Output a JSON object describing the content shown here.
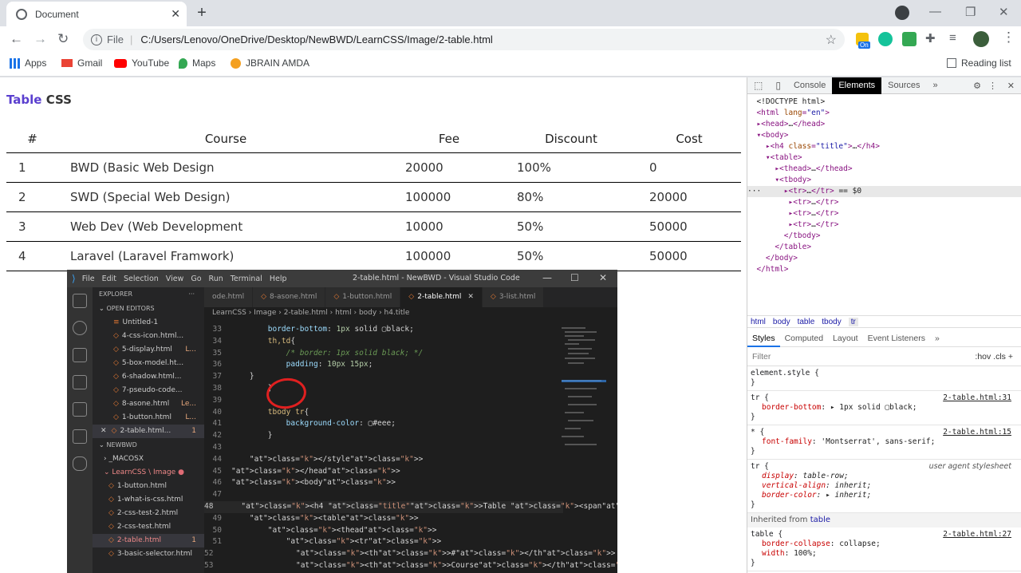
{
  "browser": {
    "tab_title": "Document",
    "tab_close": "✕",
    "new_tab": "+",
    "address_label": "File",
    "url": "C:/Users/Lenovo/OneDrive/Desktop/NewBWD/LearnCSS/Image/2-table.html",
    "extension_badge": "On",
    "bookmarks": [
      "Apps",
      "Gmail",
      "YouTube",
      "Maps",
      "JBRAIN AMDA"
    ],
    "reading_list": "Reading list"
  },
  "page": {
    "title_word1": "Table",
    "title_word2": " CSS",
    "table": {
      "headers": [
        "#",
        "Course",
        "Fee",
        "Discount",
        "Cost"
      ],
      "rows": [
        [
          "1",
          "BWD (Basic Web Design",
          "20000",
          "100%",
          "0"
        ],
        [
          "2",
          "SWD (Special Web Design)",
          "100000",
          "80%",
          "20000"
        ],
        [
          "3",
          "Web Dev (Web Development",
          "10000",
          "50%",
          "50000"
        ],
        [
          "4",
          "Laravel (Laravel Framwork)",
          "100000",
          "50%",
          "50000"
        ]
      ]
    }
  },
  "devtools": {
    "tabs": [
      "Console",
      "Elements",
      "Sources"
    ],
    "active_tab": "Elements",
    "selected_suffix": " == $0",
    "breadcrumb": [
      "html",
      "body",
      "table",
      "tbody",
      "tr"
    ],
    "style_tabs": [
      "Styles",
      "Computed",
      "Layout",
      "Event Listeners"
    ],
    "filter_placeholder": "Filter",
    "filter_tools": ":hov  .cls  +",
    "rules": [
      {
        "selector": "element.style {",
        "source": "",
        "props": []
      },
      {
        "selector": "tr {",
        "source": "2-table.html:31",
        "props": [
          [
            "border-bottom",
            "▸ 1px solid ▢black;"
          ]
        ]
      },
      {
        "selector": "* {",
        "source": "2-table.html:15",
        "props": [
          [
            "font-family",
            "'Montserrat', sans-serif;"
          ]
        ]
      },
      {
        "selector": "tr {",
        "source": "user agent stylesheet",
        "props": [
          [
            "display",
            "table-row;"
          ],
          [
            "vertical-align",
            "inherit;"
          ],
          [
            "border-color",
            "▸ inherit;"
          ]
        ]
      }
    ],
    "inherited_label": "Inherited from",
    "inherited_from": "table",
    "inherited_rule": {
      "selector": "table {",
      "source": "2-table.html:27",
      "props": [
        [
          "border-collapse",
          "collapse;"
        ],
        [
          "width",
          "100%;"
        ]
      ]
    }
  },
  "vscode": {
    "menus": [
      "File",
      "Edit",
      "Selection",
      "View",
      "Go",
      "Run",
      "Terminal",
      "Help"
    ],
    "window_title": "2-table.html - NewBWD - Visual Studio Code",
    "explorer_label": "EXPLORER",
    "open_editors_label": "OPEN EDITORS",
    "open_editors": [
      {
        "name": "Untitled-1",
        "extra": ""
      },
      {
        "name": "4-css-icon.html...",
        "extra": ""
      },
      {
        "name": "5-display.html",
        "extra": "L..."
      },
      {
        "name": "5-box-model.ht...",
        "extra": ""
      },
      {
        "name": "6-shadow.html...",
        "extra": ""
      },
      {
        "name": "7-pseudo-code...",
        "extra": ""
      },
      {
        "name": "8-asone.html",
        "extra": "Le..."
      },
      {
        "name": "1-button.html",
        "extra": "L..."
      },
      {
        "name": "2-table.html...",
        "extra": "1"
      }
    ],
    "workspace_label": "NEWBWD",
    "folders": [
      "_MACOSX",
      "LearnCSS \\ Image"
    ],
    "files": [
      {
        "name": "1-button.html",
        "extra": ""
      },
      {
        "name": "1-what-is-css.html",
        "extra": ""
      },
      {
        "name": "2-css-test-2.html",
        "extra": ""
      },
      {
        "name": "2-css-test.html",
        "extra": ""
      },
      {
        "name": "2-table.html",
        "extra": "1"
      },
      {
        "name": "3-basic-selector.html",
        "extra": ""
      }
    ],
    "editor_tabs": [
      "ode.html",
      "8-asone.html",
      "1-button.html",
      "2-table.html",
      "3-list.html"
    ],
    "breadcrumb": "LearnCSS  ›  Image  ›  2-table.html  ›  html  ›  body  ›  h4.title",
    "line_numbers": [
      "33",
      "34",
      "35",
      "36",
      "37",
      "38",
      "39",
      "40",
      "41",
      "42",
      "43",
      "44",
      "45",
      "46",
      "47",
      "48",
      "49",
      "50",
      "51",
      "52",
      "53"
    ],
    "code": [
      "        border-bottom: 1px solid ▢black;",
      "        th,td{",
      "            /* border: 1px solid black; */",
      "            padding: 10px 15px;",
      "    }",
      "        }",
      "",
      "        tbody tr{",
      "            background-color: ▢#eee;",
      "        }",
      "",
      "    </style>",
      "</head>",
      "<body>",
      "",
      "    <h4 class=\"title\">Table <span>CSS</span></h4>",
      "    <table>",
      "        <thead>",
      "            <tr>",
      "                <th>#</th>",
      "                <th>Course</th>"
    ]
  }
}
